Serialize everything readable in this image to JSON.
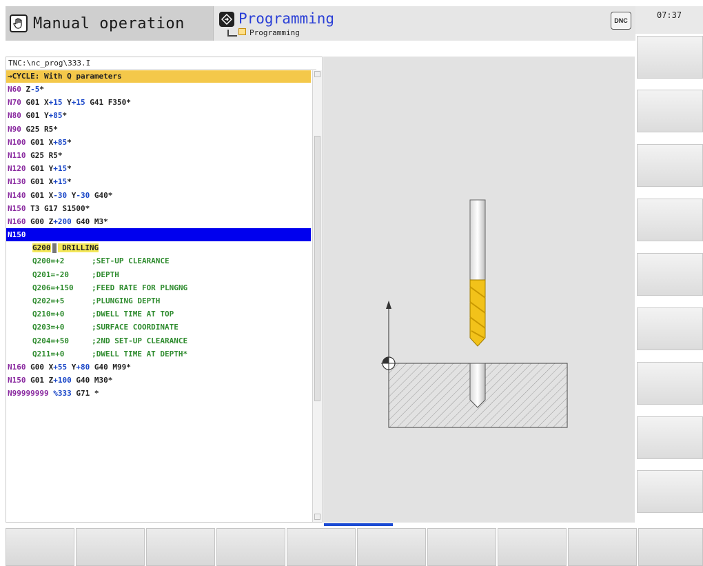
{
  "header": {
    "mode_manual_label": "Manual operation",
    "mode_programming_label": "Programming",
    "mode_programming_sub": "Programming",
    "dnc_label": "DNC",
    "clock": "07:37"
  },
  "program": {
    "path": "TNC:\\nc_prog\\333.I",
    "cycle_banner": "→CYCLE: With Q parameters",
    "lines": [
      {
        "n": "N60",
        "rest": [
          [
            "t",
            " Z"
          ],
          [
            "v",
            "-5"
          ],
          [
            "t",
            "*"
          ]
        ]
      },
      {
        "n": "N70",
        "rest": [
          [
            "t",
            " G01 X"
          ],
          [
            "v",
            "+15"
          ],
          [
            "t",
            " Y"
          ],
          [
            "v",
            "+15"
          ],
          [
            "t",
            " G41 F350*"
          ]
        ]
      },
      {
        "n": "N80",
        "rest": [
          [
            "t",
            " G01 Y"
          ],
          [
            "v",
            "+85"
          ],
          [
            "t",
            "*"
          ]
        ]
      },
      {
        "n": "N90",
        "rest": [
          [
            "t",
            " G25 R5*"
          ]
        ]
      },
      {
        "n": "N100",
        "rest": [
          [
            "t",
            " G01 X"
          ],
          [
            "v",
            "+85"
          ],
          [
            "t",
            "*"
          ]
        ]
      },
      {
        "n": "N110",
        "rest": [
          [
            "t",
            " G25 R5*"
          ]
        ]
      },
      {
        "n": "N120",
        "rest": [
          [
            "t",
            " G01 Y"
          ],
          [
            "v",
            "+15"
          ],
          [
            "t",
            "*"
          ]
        ]
      },
      {
        "n": "N130",
        "rest": [
          [
            "t",
            " G01 X"
          ],
          [
            "v",
            "+15"
          ],
          [
            "t",
            "*"
          ]
        ]
      },
      {
        "n": "N140",
        "rest": [
          [
            "t",
            " G01 X"
          ],
          [
            "v",
            "-30"
          ],
          [
            "t",
            " Y"
          ],
          [
            "v",
            "-30"
          ],
          [
            "t",
            " G40*"
          ]
        ]
      },
      {
        "n": "N150",
        "rest": [
          [
            "t",
            " T3 G17 S1500*"
          ]
        ]
      },
      {
        "n": "N160",
        "rest": [
          [
            "t",
            " G00 Z"
          ],
          [
            "v",
            "+200"
          ],
          [
            "t",
            " G40 M3*"
          ]
        ]
      }
    ],
    "selected_line": "N150",
    "cycle_line": {
      "code": "G200",
      "name": " DRILLING"
    },
    "params": [
      "Q200=+2      ;SET-UP CLEARANCE",
      "Q201=-20     ;DEPTH",
      "Q206=+150    ;FEED RATE FOR PLNGNG",
      "Q202=+5      ;PLUNGING DEPTH",
      "Q210=+0      ;DWELL TIME AT TOP",
      "Q203=+0      ;SURFACE COORDINATE",
      "Q204=+50     ;2ND SET-UP CLEARANCE",
      "Q211=+0      ;DWELL TIME AT DEPTH*"
    ],
    "tail_lines": [
      {
        "n": "N160",
        "rest": [
          [
            "t",
            " G00 X"
          ],
          [
            "v",
            "+55"
          ],
          [
            "t",
            " Y"
          ],
          [
            "v",
            "+80"
          ],
          [
            "t",
            " G40 M99*"
          ]
        ]
      },
      {
        "n": "N150",
        "rest": [
          [
            "t",
            " G01 Z"
          ],
          [
            "v",
            "+100"
          ],
          [
            "t",
            " G40 M30*"
          ]
        ]
      },
      {
        "n": "N99999999",
        "rest": [
          [
            "v",
            " %333"
          ],
          [
            "t",
            " G71 *"
          ]
        ]
      }
    ]
  },
  "colors": {
    "line_number": "#8a2aa0",
    "value": "#1a47c8",
    "param": "#2e8b2e",
    "selection": "#0000ee",
    "cycle_banner": "#f4c84a",
    "drill_flute": "#f2c21a"
  },
  "icons": {
    "manual": "hand-icon",
    "programming": "diamond-arrow-icon",
    "dnc": "dnc-icon",
    "origin": "crosshair-circle-icon"
  }
}
